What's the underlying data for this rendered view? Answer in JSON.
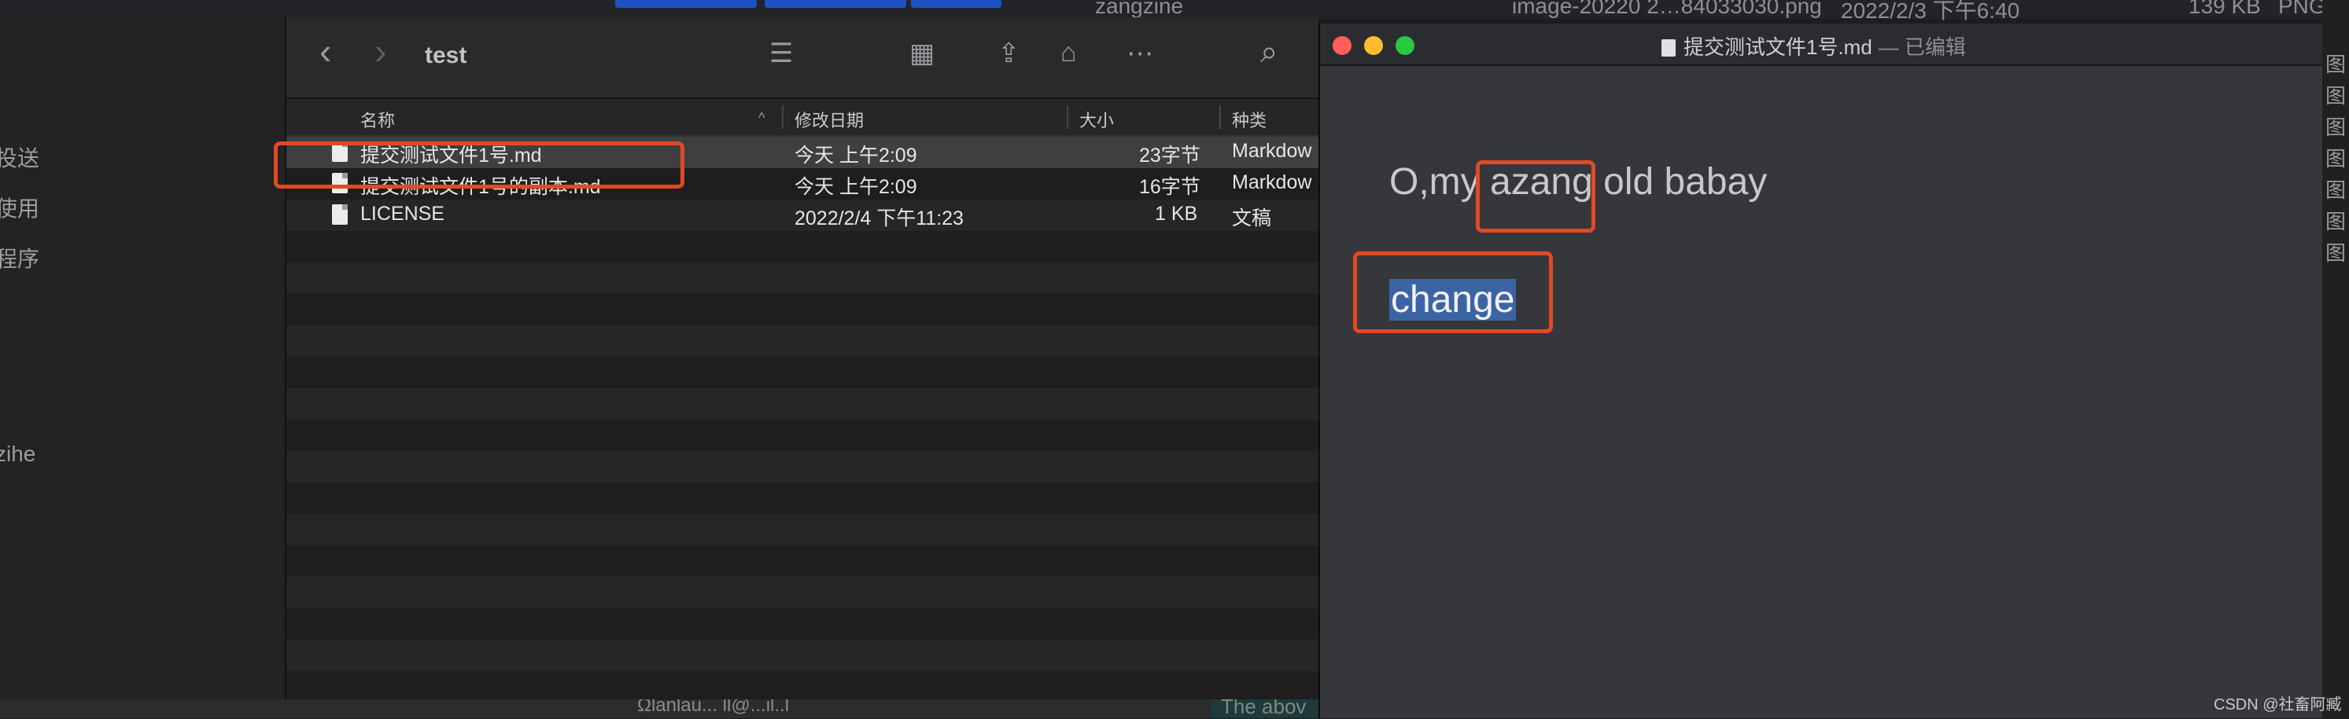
{
  "background": {
    "top_texts": [
      "zangzine",
      "image-20220 2…84033030.png",
      "2022/2/3 下午6:40",
      "139 KB",
      "PNG"
    ],
    "bottom_hint": "The abov",
    "bottom_left_text": "Ωlanlau... ll@...il..l"
  },
  "finder": {
    "toolbar": {
      "back_glyph": "‹",
      "forward_glyph": "›",
      "title": "test",
      "view_list_glyph": "☰",
      "view_grid_glyph": "▦",
      "share_glyph": "⇪",
      "tag_glyph": "⌂",
      "more_glyph": "⋯",
      "search_glyph": "⌕"
    },
    "sidebar": {
      "items": [
        "投送",
        "使用",
        "程序",
        "zihe"
      ]
    },
    "columns": {
      "name": "名称",
      "modified": "修改日期",
      "size": "大小",
      "kind": "种类",
      "sort_glyph": "^"
    },
    "rows": [
      {
        "name": "提交测试文件1号.md",
        "modified": "今天 上午2:09",
        "size": "23字节",
        "kind": "Markdow"
      },
      {
        "name": "提交测试文件1号的副本.md",
        "modified": "今天 上午2:09",
        "size": "16字节",
        "kind": "Markdow"
      },
      {
        "name": "LICENSE",
        "modified": "2022/2/4 下午11:23",
        "size": "1 KB",
        "kind": "文稿"
      }
    ]
  },
  "editor": {
    "title": "提交测试文件1号.md",
    "status": "— 已编辑",
    "line1_prefix": "O,my ",
    "line1_highlight": "azang",
    "line1_suffix": " old babay",
    "line2": "change"
  },
  "right_strip": [
    "图",
    "图",
    "图",
    "图",
    "图",
    "图",
    "图"
  ],
  "watermark": "CSDN @社畜阿臧",
  "colors": {
    "annotation": "#e14a23",
    "selection": "#3b64a5",
    "traffic_close": "#ff5f57",
    "traffic_min": "#febc2e",
    "traffic_max": "#28c840"
  }
}
